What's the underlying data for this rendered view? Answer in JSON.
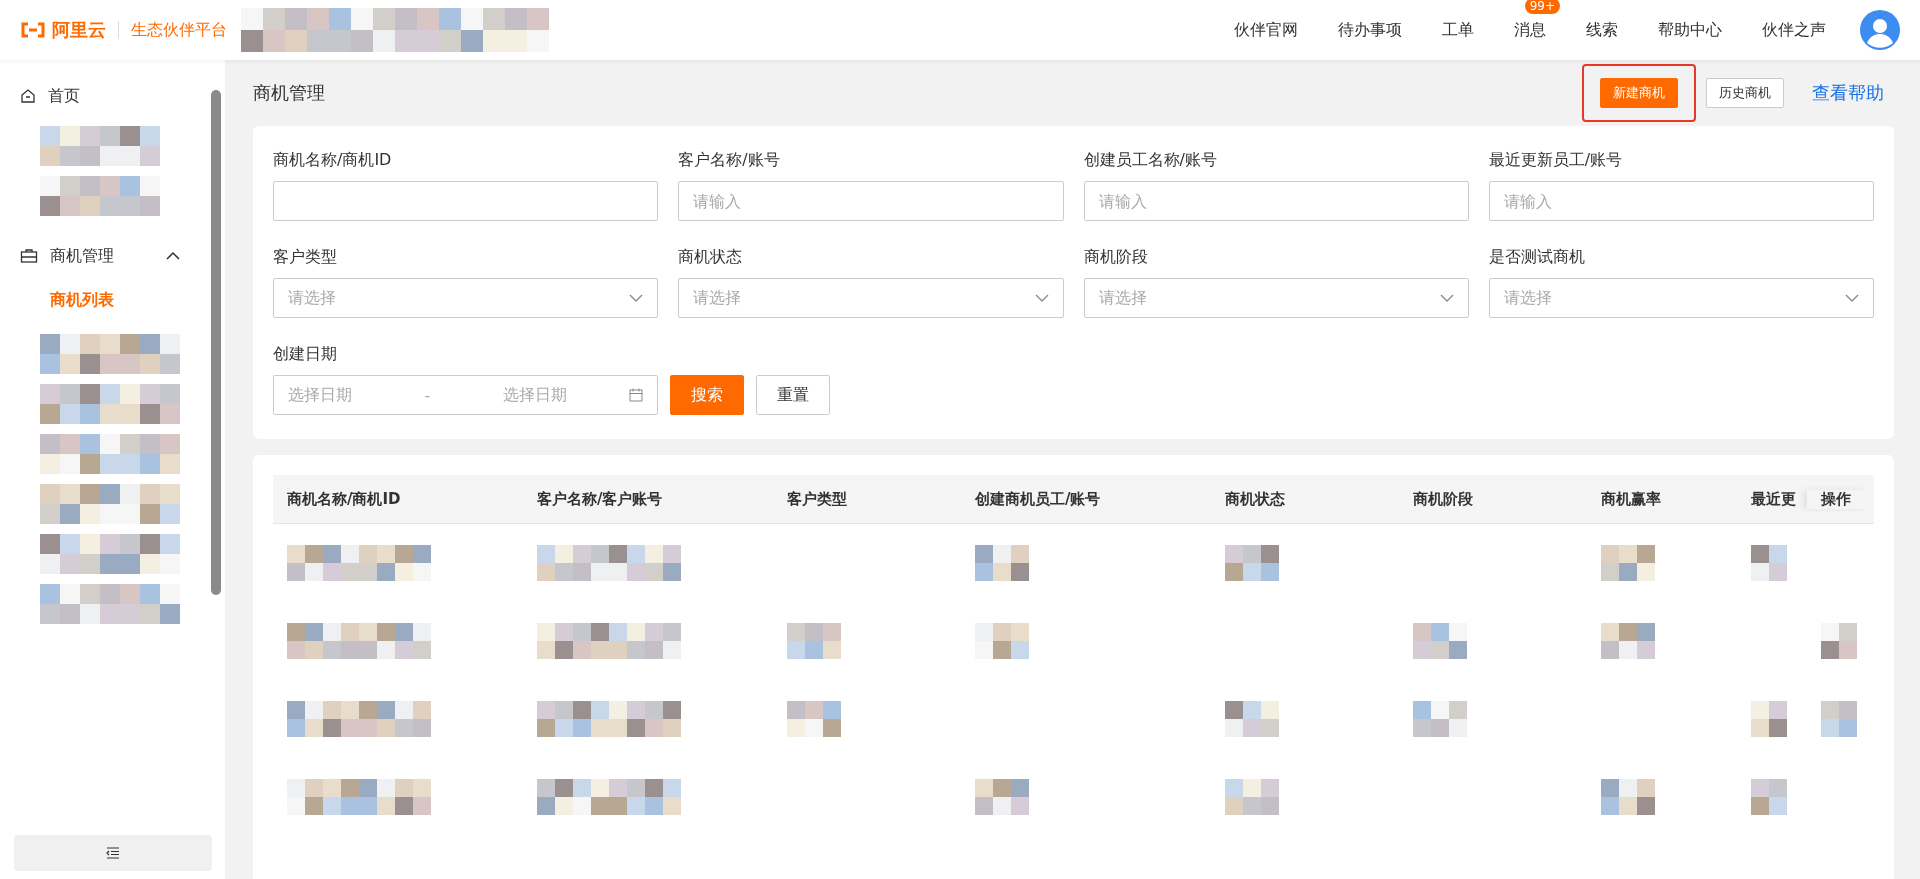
{
  "header": {
    "logo_text": "阿里云",
    "platform_name": "生态伙伴平台",
    "nav": [
      {
        "label": "伙伴官网"
      },
      {
        "label": "待办事项"
      },
      {
        "label": "工单"
      },
      {
        "label": "消息",
        "badge": "99+"
      },
      {
        "label": "线索"
      },
      {
        "label": "帮助中心"
      },
      {
        "label": "伙伴之声"
      }
    ]
  },
  "sidebar": {
    "items": [
      {
        "kind": "link",
        "label": "首页",
        "selected": false
      },
      {
        "kind": "group",
        "label": "商机管理",
        "expanded": true
      },
      {
        "kind": "sub",
        "label": "商机列表",
        "selected": true
      }
    ]
  },
  "page": {
    "title": "商机管理",
    "actions": [
      {
        "kind": "primary",
        "label": "新建商机",
        "highlighted": true
      },
      {
        "kind": "default",
        "label": "历史商机",
        "highlighted": false
      },
      {
        "kind": "link",
        "label": "查看帮助",
        "highlighted": false
      }
    ]
  },
  "filters": [
    {
      "kind": "input",
      "label": "商机名称/商机ID"
    },
    {
      "kind": "input",
      "label": "客户名称/账号",
      "placeholder": "请输入"
    },
    {
      "kind": "input",
      "label": "创建员工名称/账号",
      "placeholder": "请输入"
    },
    {
      "kind": "input",
      "label": "最近更新员工/账号",
      "placeholder": "请输入"
    },
    {
      "kind": "select",
      "label": "客户类型",
      "placeholder": "请选择"
    },
    {
      "kind": "select",
      "label": "商机状态",
      "placeholder": "请选择"
    },
    {
      "kind": "select",
      "label": "商机阶段",
      "placeholder": "请选择"
    },
    {
      "kind": "select",
      "label": "是否测试商机",
      "placeholder": "请选择"
    },
    {
      "kind": "daterange",
      "label": "创建日期",
      "start_placeholder": "选择日期",
      "separator": "-",
      "end_placeholder": "选择日期"
    }
  ],
  "filter_buttons": [
    {
      "kind": "primary",
      "label": "搜索"
    },
    {
      "kind": "default",
      "label": "重置"
    }
  ],
  "table": {
    "columns": [
      "商机名称/商机ID",
      "客户名称/客户账号",
      "客户类型",
      "创建商机员工/账号",
      "商机状态",
      "商机阶段",
      "商机赢率",
      "最近更",
      "操作"
    ]
  }
}
